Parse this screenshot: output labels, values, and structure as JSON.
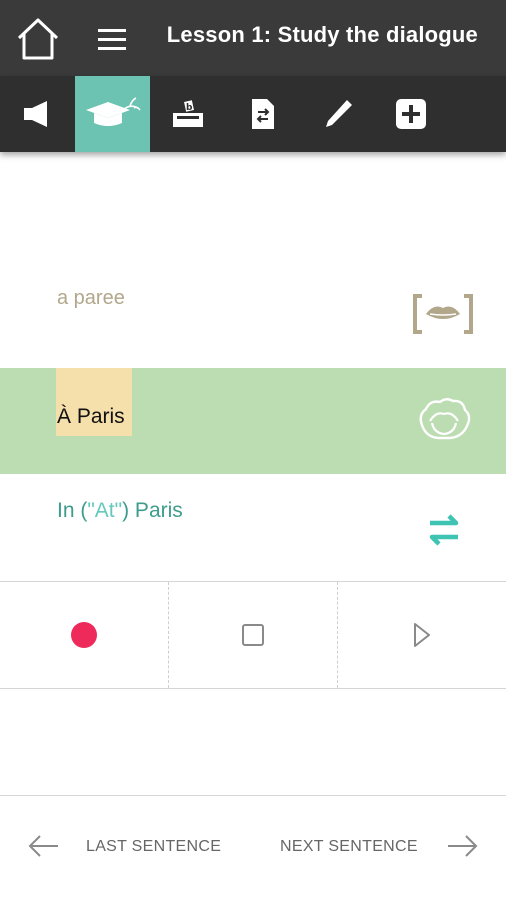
{
  "header": {
    "title": "Lesson 1: Study the dialogue",
    "background": "#3a3a3a"
  },
  "toolbar": {
    "active_index": 1,
    "active_color": "#6cc3b2",
    "items": [
      {
        "icon": "speaker-icon"
      },
      {
        "icon": "graduation-cap-icon"
      },
      {
        "icon": "ballot-box-icon"
      },
      {
        "icon": "document-swap-icon"
      },
      {
        "icon": "pencil-icon"
      },
      {
        "icon": "plus-box-icon"
      }
    ]
  },
  "sentence": {
    "phonetic": "a paree",
    "original": "À Paris",
    "translation_prefix": "In (",
    "translation_quote": "\"At\"",
    "translation_suffix": ") Paris"
  },
  "colors": {
    "phonetic": "#b2a78b",
    "highlight_row": "#bcdcb2",
    "word_highlight": "#f5dfaa",
    "translation": "#3e9c8d",
    "swap_icon": "#3fc3b2",
    "record": "#ee2a5a"
  },
  "controls": [
    {
      "icon": "record-icon"
    },
    {
      "icon": "stop-icon"
    },
    {
      "icon": "play-icon"
    }
  ],
  "footer": {
    "last_label": "LAST SENTENCE",
    "next_label": "NEXT SENTENCE"
  }
}
